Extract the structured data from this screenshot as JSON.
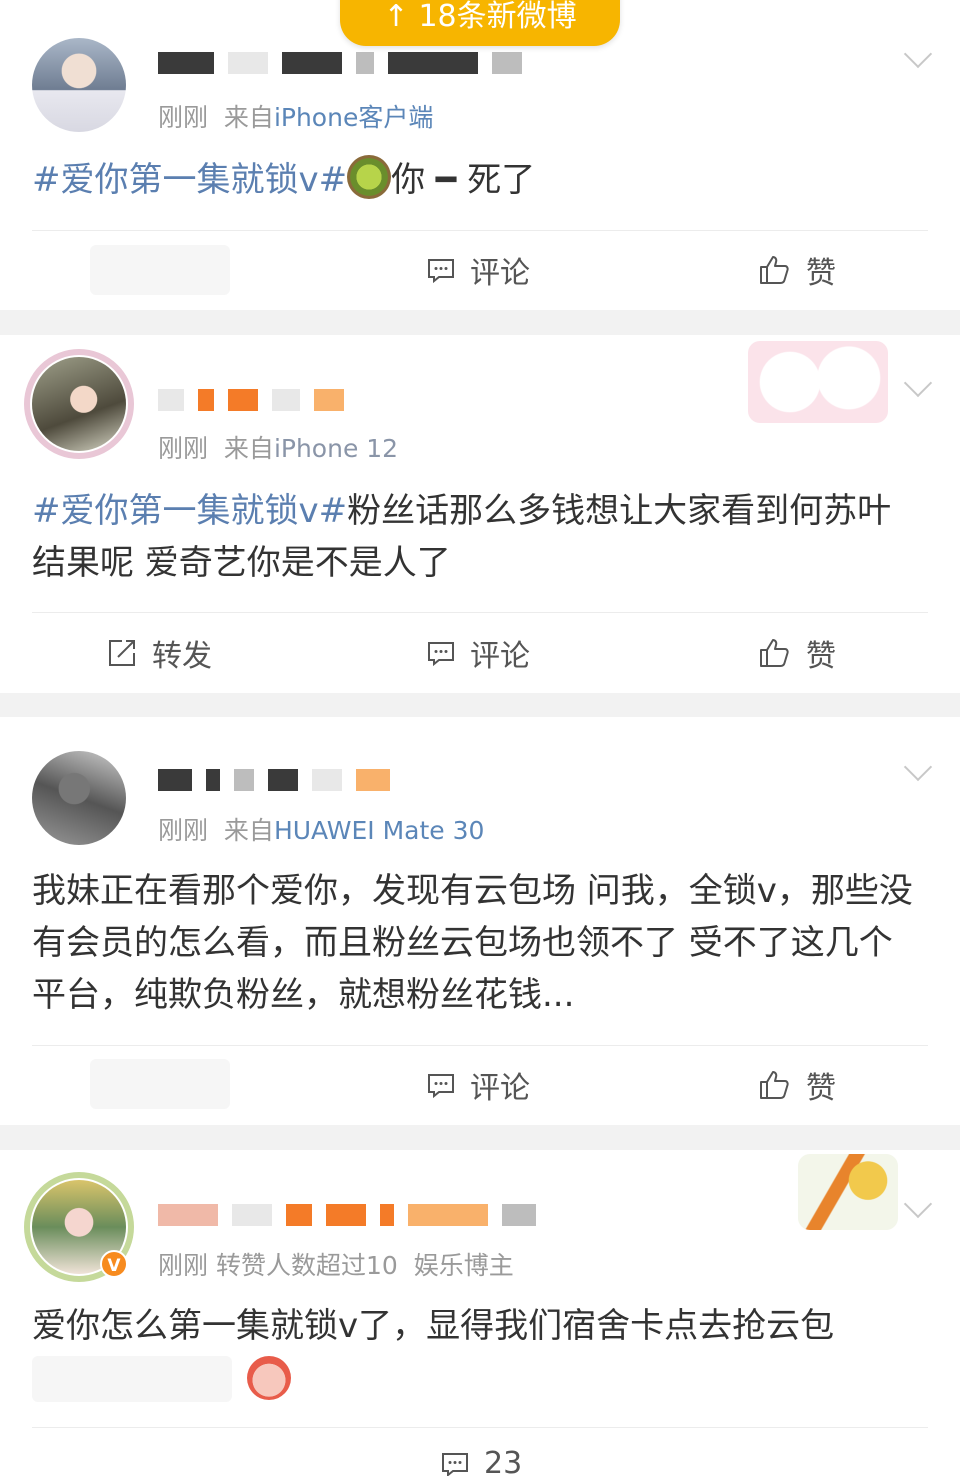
{
  "toast": {
    "arrow": "↑",
    "label": "18条新微博"
  },
  "posts": [
    {
      "meta": {
        "time": "刚刚",
        "from_prefix": "来自",
        "source": "iPhone客户端"
      },
      "text_hashtag": "#爱你第一集就锁v#",
      "text_rest": "你 ━ 死了",
      "actions": {
        "comment": "评论",
        "like": "赞"
      }
    },
    {
      "meta": {
        "time": "刚刚",
        "from_prefix": "来自",
        "source": "iPhone 12"
      },
      "text_hashtag": "#爱你第一集就锁v#",
      "text_rest": "粉丝话那么多钱想让大家看到何苏叶结果呢 爱奇艺你是不是人了",
      "actions": {
        "repost": "转发",
        "comment": "评论",
        "like": "赞"
      }
    },
    {
      "meta": {
        "time": "刚刚",
        "from_prefix": "来自",
        "source": "HUAWEI Mate 30"
      },
      "text": "我妹正在看那个爱你，发现有云包场 问我，全锁v，那些没有会员的怎么看，而且粉丝云包场也领不了 受不了这几个平台，纯欺负粉丝，就想粉丝花钱...",
      "actions": {
        "comment": "评论",
        "like": "赞"
      }
    },
    {
      "meta": {
        "time": "刚刚",
        "extra": "转赞人数超过10",
        "tag": "娱乐博主"
      },
      "verified_badge": "V",
      "text": "爱你怎么第一集就锁v了，显得我们宿舍卡点去抢云包",
      "actions": {
        "comment_count": "23"
      }
    }
  ],
  "colors": {
    "accent": "#f7b500",
    "hashtag": "#5b7fb0",
    "source_link": "#5b86b8",
    "verified": "#f78b1f"
  }
}
